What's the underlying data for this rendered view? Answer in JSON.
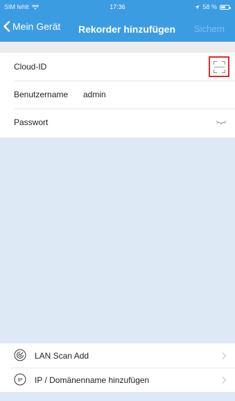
{
  "status_bar": {
    "carrier": "SIM fehlt",
    "time": "17:36",
    "battery_text": "58 %",
    "battery_level": 0.58
  },
  "nav": {
    "back_label": "Mein Gerät",
    "title": "Rekorder hinzufügen",
    "save_label": "Sichern"
  },
  "form": {
    "cloud_id_label": "Cloud-ID",
    "username_label": "Benutzername",
    "username_value": "admin",
    "password_label": "Passwort"
  },
  "bottom_list": {
    "items": [
      {
        "label": "LAN Scan Add",
        "icon": "lan-scan-icon"
      },
      {
        "label": "IP / Domänenname hinzufügen",
        "icon": "ip-icon"
      }
    ]
  },
  "colors": {
    "header": "#3c9ce2",
    "background": "#dde9f4",
    "highlight": "#e02a2a"
  }
}
